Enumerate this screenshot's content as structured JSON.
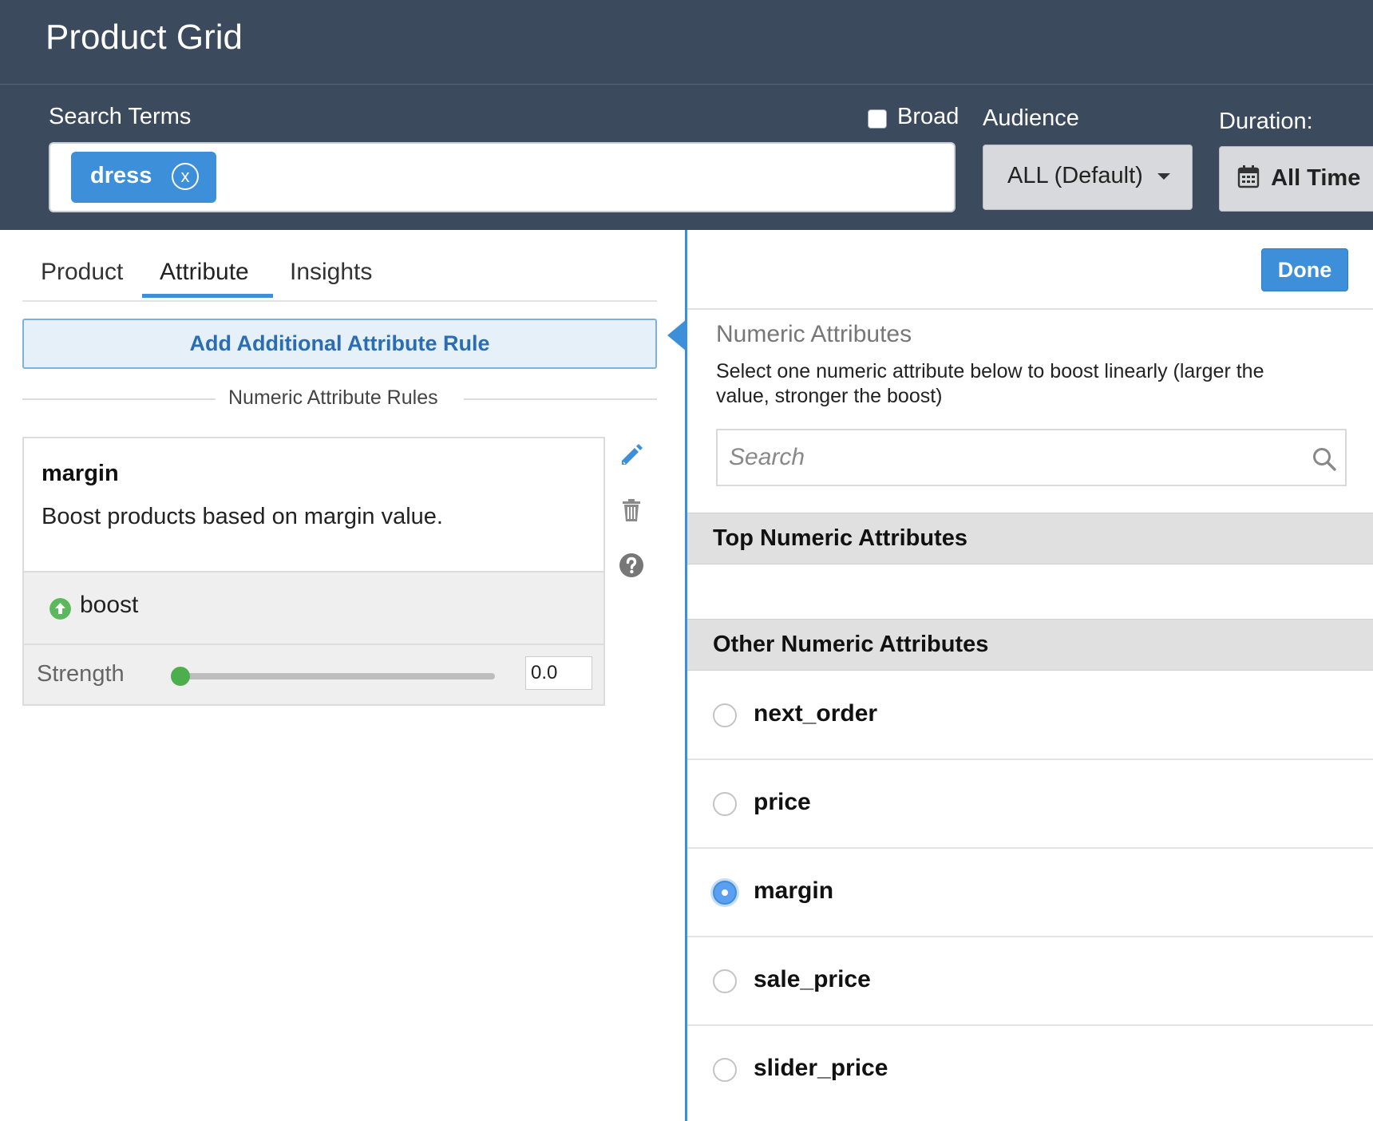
{
  "header": {
    "title": "Product Grid",
    "search_label": "Search Terms",
    "broad_label": "Broad",
    "audience_label": "Audience",
    "duration_label": "Duration:",
    "tag": "dress",
    "tag_remove": "x",
    "audience_value": "ALL (Default)",
    "duration_value": "All Time"
  },
  "tabs": [
    "Product",
    "Attribute",
    "Insights"
  ],
  "left": {
    "add_rule": "Add Additional Attribute Rule",
    "section_title": "Numeric Attribute Rules",
    "rule": {
      "name": "margin",
      "description": "Boost products based on margin value.",
      "type": "boost",
      "strength_label": "Strength",
      "strength_value": "0.0"
    }
  },
  "right": {
    "done": "Done",
    "title": "Numeric Attributes",
    "description": "Select one numeric attribute below to boost linearly (larger the value, stronger the boost)",
    "search_placeholder": "Search",
    "top_section": "Top Numeric Attributes",
    "other_section": "Other Numeric Attributes",
    "options": [
      "next_order",
      "price",
      "margin",
      "sale_price",
      "slider_price"
    ],
    "selected": "margin"
  },
  "colors": {
    "header_bg": "#3c4a5e",
    "accent": "#3d8fd9",
    "boost_green": "#5cb85c"
  }
}
